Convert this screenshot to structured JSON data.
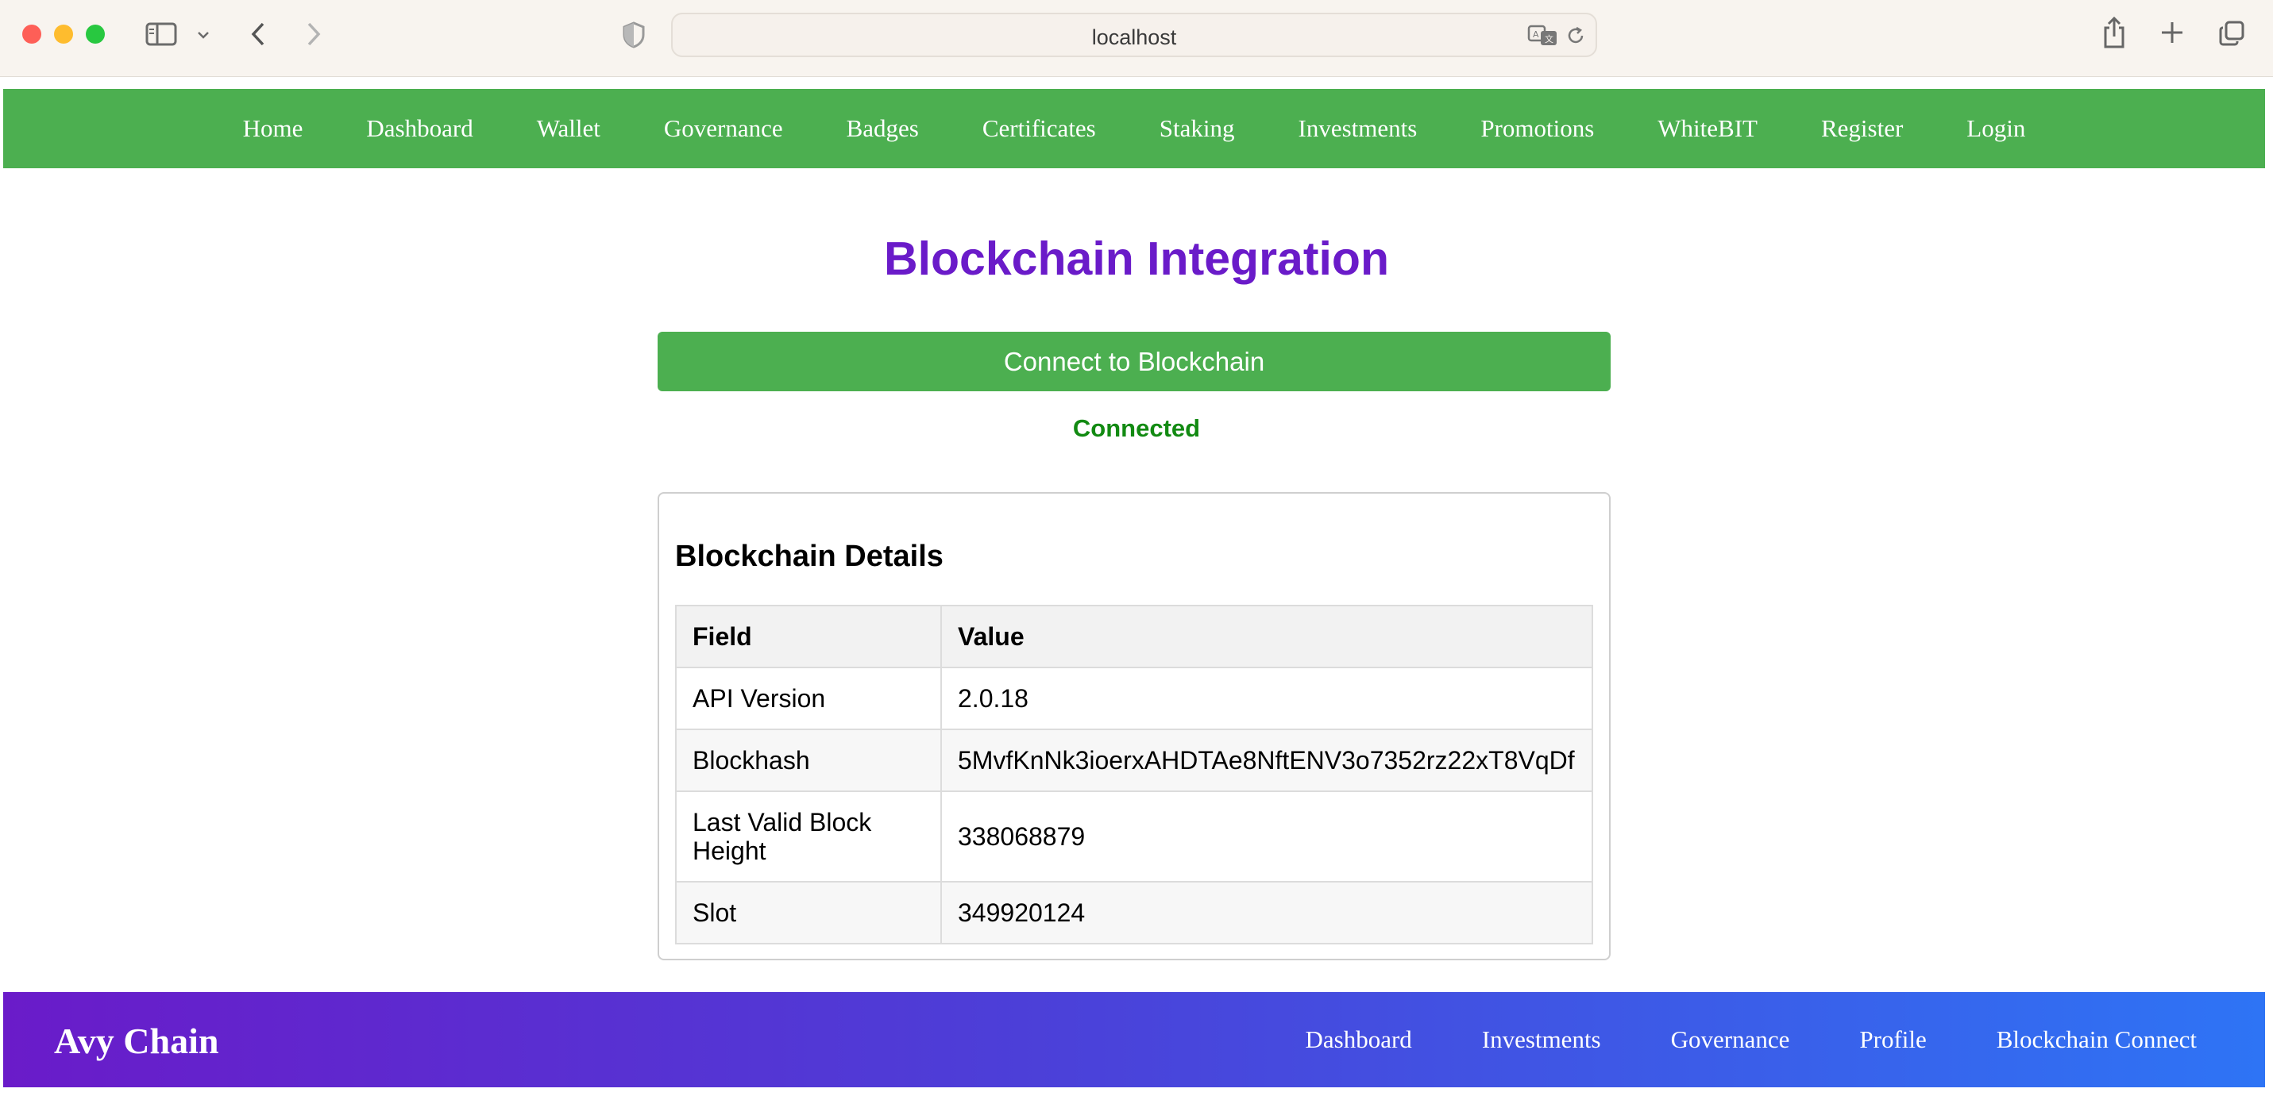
{
  "browser": {
    "url": "localhost",
    "icons": [
      "sidebar-icon",
      "chevron-down-icon",
      "back-icon",
      "forward-icon",
      "shield-icon",
      "translate-icon",
      "reload-icon",
      "share-icon",
      "new-tab-icon",
      "tabs-overview-icon"
    ]
  },
  "nav": {
    "items": [
      "Home",
      "Dashboard",
      "Wallet",
      "Governance",
      "Badges",
      "Certificates",
      "Staking",
      "Investments",
      "Promotions",
      "WhiteBIT",
      "Register",
      "Login"
    ]
  },
  "main": {
    "title": "Blockchain Integration",
    "connect_label": "Connect to Blockchain",
    "status": "Connected",
    "details": {
      "heading": "Blockchain Details",
      "columns": [
        "Field",
        "Value"
      ],
      "rows": [
        {
          "field": "API Version",
          "value": "2.0.18"
        },
        {
          "field": "Blockhash",
          "value": "5MvfKnNk3ioerxAHDTAe8NftENV3o7352rz22xT8VqDf"
        },
        {
          "field": "Last Valid Block Height",
          "value": "338068879"
        },
        {
          "field": "Slot",
          "value": "349920124"
        }
      ]
    }
  },
  "footer": {
    "brand": "Avy Chain",
    "links": [
      "Dashboard",
      "Investments",
      "Governance",
      "Profile",
      "Blockchain Connect"
    ]
  },
  "colors": {
    "nav_green": "#4caf50",
    "title_purple": "#6a1bc9",
    "status_green": "#128a12",
    "footer_gradient_start": "#6a1bc9",
    "footer_gradient_end": "#2e74f5"
  }
}
